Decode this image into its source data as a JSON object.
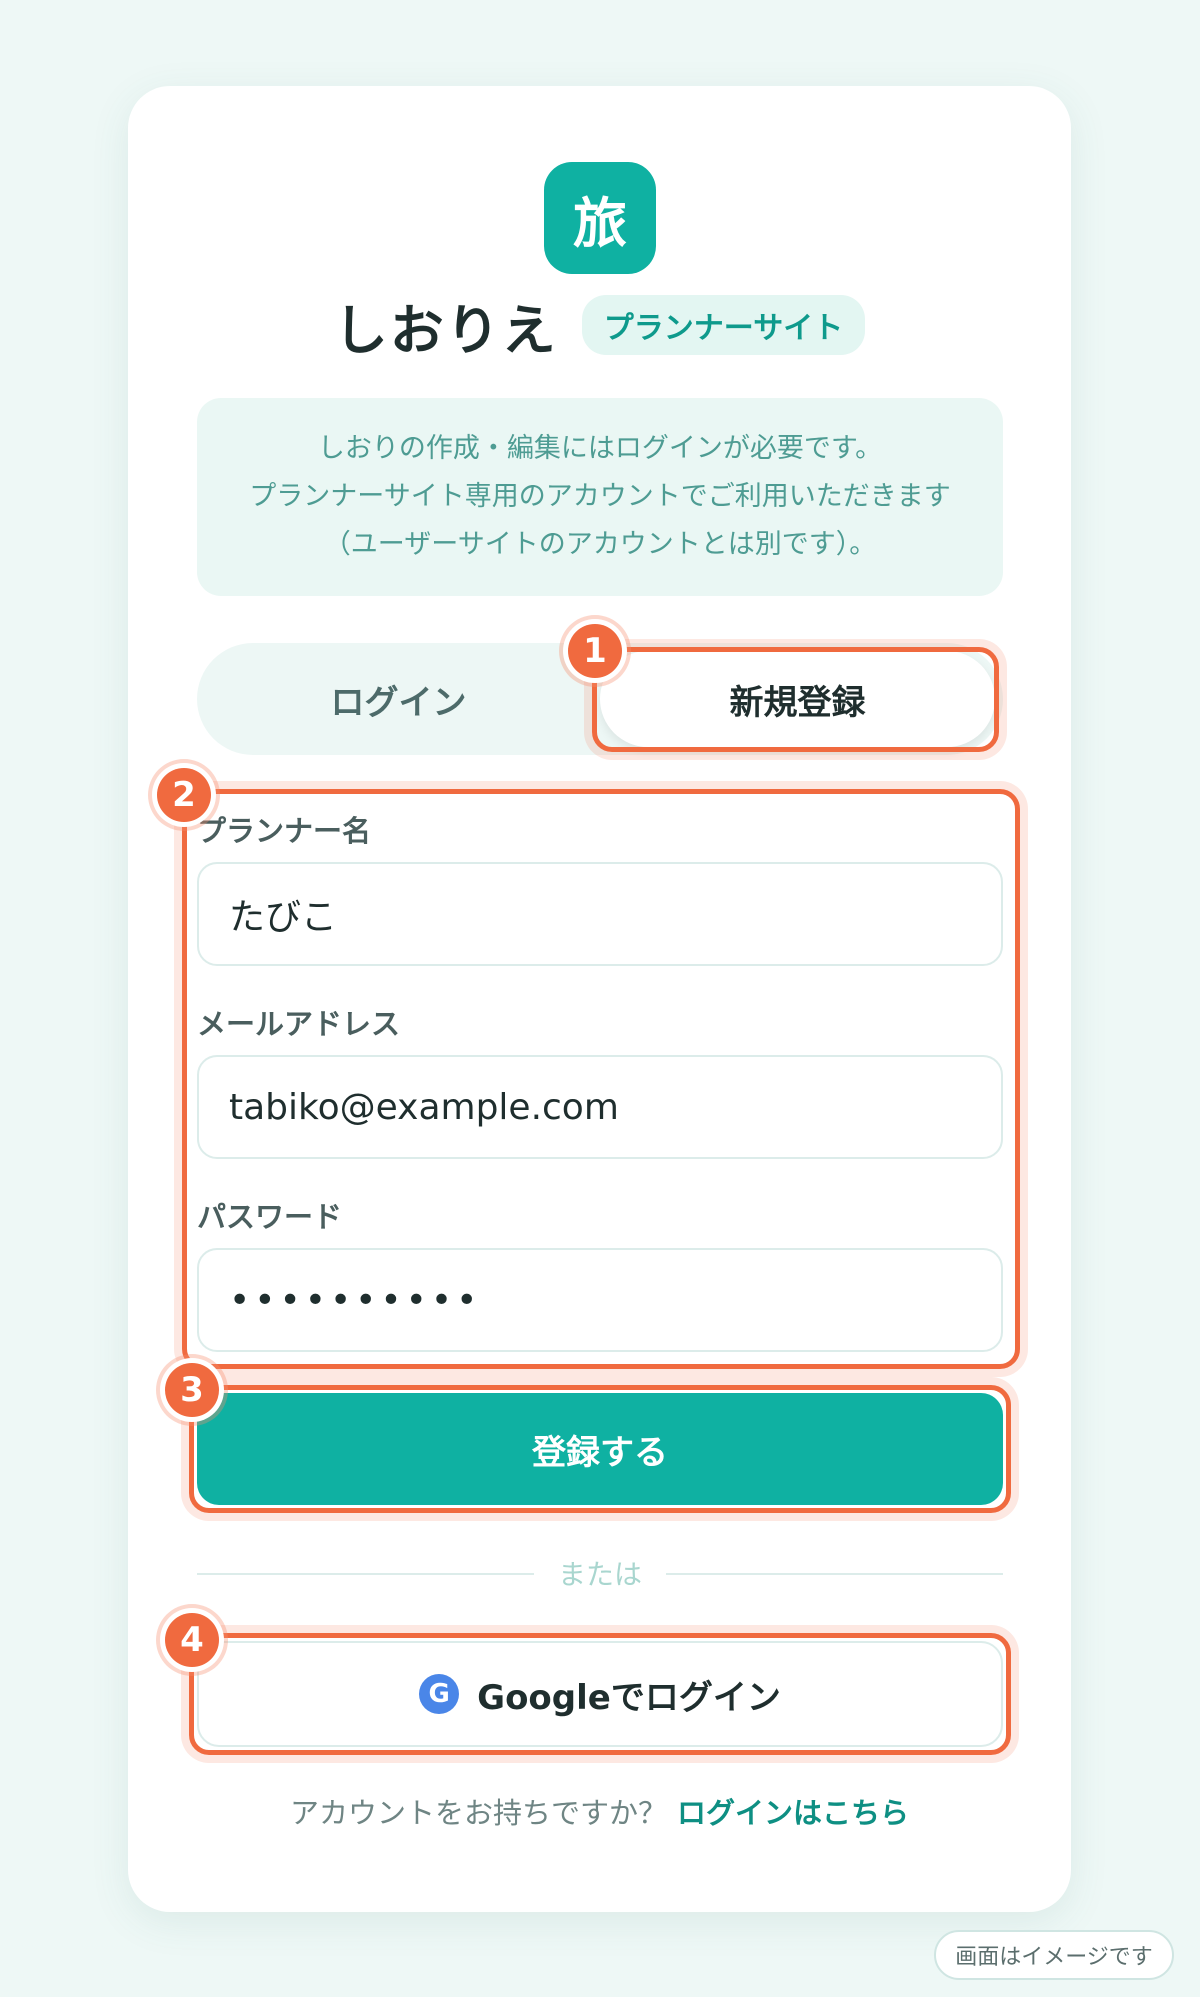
{
  "brand": {
    "logo_char": "旅",
    "title": "しおりえ",
    "badge": "プランナーサイト"
  },
  "notice": {
    "line1": "しおりの作成・編集にはログインが必要です。",
    "line2": "プランナーサイト専用のアカウントでご利用いただきます",
    "line3": "（ユーザーサイトのアカウントとは別です）。"
  },
  "tabs": {
    "login": "ログイン",
    "signup": "新規登録",
    "active": "signup"
  },
  "form": {
    "name_label": "プランナー名",
    "name_value": "たびこ",
    "email_label": "メールアドレス",
    "email_value": "tabiko@example.com",
    "password_label": "パスワード",
    "password_value": "••••••••••"
  },
  "submit_label": "登録する",
  "divider_text": "または",
  "google": {
    "icon_letter": "G",
    "label": "Googleでログイン"
  },
  "footer": {
    "question": "アカウントをお持ちですか？",
    "link": "ログインはこちら"
  },
  "image_note": "画面はイメージです",
  "annotations": [
    "1",
    "2",
    "3",
    "4"
  ],
  "colors": {
    "accent": "#0fb1a2",
    "highlight": "#f06a3f",
    "background": "#eef8f6"
  }
}
